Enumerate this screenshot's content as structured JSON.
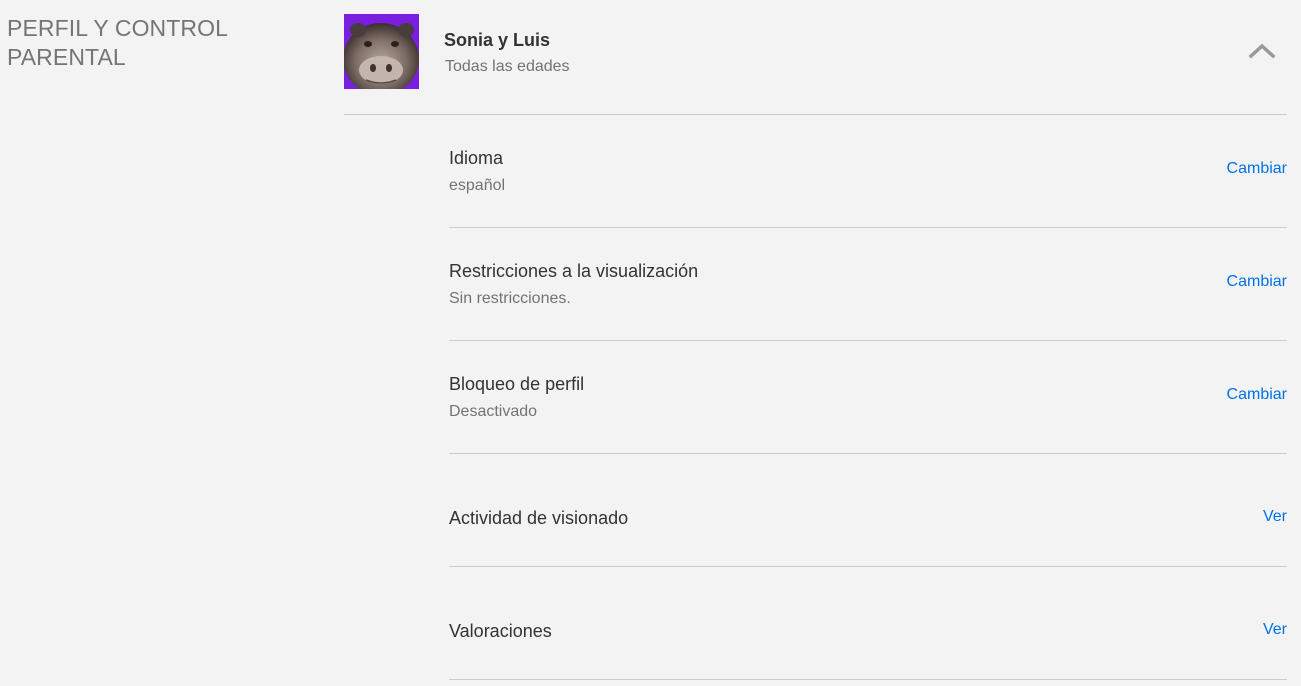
{
  "section": {
    "title": "PERFIL Y CONTROL PARENTAL"
  },
  "profile": {
    "name": "Sonia y Luis",
    "maturity": "Todas las edades",
    "avatar_icon": "hippo-avatar",
    "expanded": true
  },
  "colors": {
    "background": "#f3f3f3",
    "link": "#0071eb",
    "avatar_bg": "#7a1ee0"
  },
  "settings": [
    {
      "title": "Idioma",
      "value": "español",
      "action": "Cambiar"
    },
    {
      "title": "Restricciones a la visualización",
      "value": "Sin restricciones.",
      "action": "Cambiar"
    },
    {
      "title": "Bloqueo de perfil",
      "value": "Desactivado",
      "action": "Cambiar"
    },
    {
      "title": "Actividad de visionado",
      "value": "",
      "action": "Ver"
    },
    {
      "title": "Valoraciones",
      "value": "",
      "action": "Ver"
    }
  ]
}
